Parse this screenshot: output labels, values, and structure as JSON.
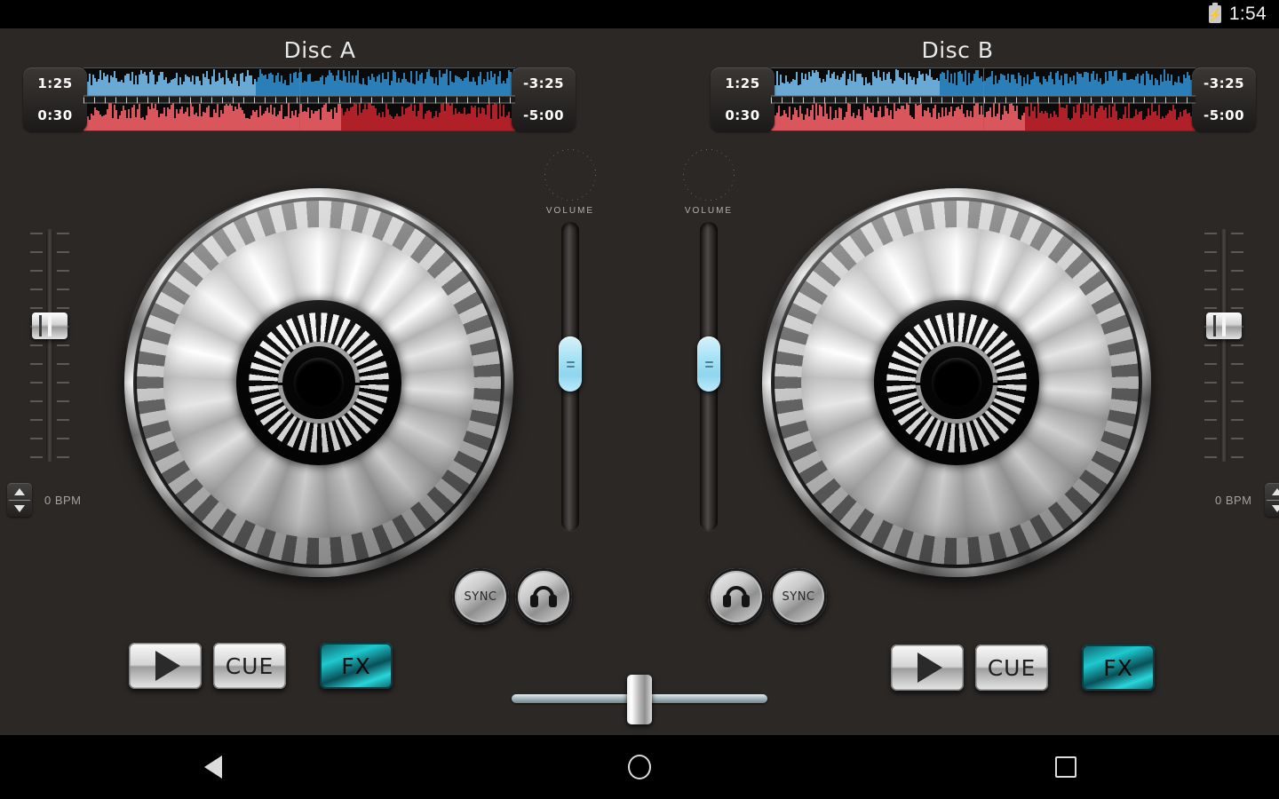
{
  "status_bar": {
    "battery_icon": "battery-charging-icon",
    "time": "1:54"
  },
  "nav_bar": {
    "back_icon": "back-triangle-icon",
    "home_icon": "home-circle-icon",
    "recents_icon": "recents-square-icon"
  },
  "colors": {
    "background": "#2b2826",
    "waveform_top": "#2b7fb8",
    "waveform_bottom": "#b02028",
    "waveform_played_top": "#6aa9d4",
    "waveform_played_bottom": "#d9565c",
    "playhead": "#ff3b30",
    "fx_accent": "#1ec9cf",
    "volume_handle": "#a6e2f5"
  },
  "decks": [
    {
      "id": "a",
      "title": "Disc A",
      "elapsed": "1:25",
      "cue_time": "0:30",
      "remaining": "-3:25",
      "total_remaining": "-5:00",
      "bpm": "0 BPM",
      "play_label": "",
      "cue_label": "CUE",
      "fx_label": "FX",
      "sync_label": "SYNC",
      "monitor_icon": "headphones-icon",
      "volume_knob_label": "VOLUME",
      "play_icon": "play-triangle-icon",
      "pitch_value": 0,
      "channel_volume": 55,
      "playhead_percent": 50
    },
    {
      "id": "b",
      "title": "Disc B",
      "elapsed": "1:25",
      "cue_time": "0:30",
      "remaining": "-3:25",
      "total_remaining": "-5:00",
      "bpm": "0 BPM",
      "play_label": "",
      "cue_label": "CUE",
      "fx_label": "FX",
      "sync_label": "SYNC",
      "monitor_icon": "headphones-icon",
      "volume_knob_label": "VOLUME",
      "play_icon": "play-triangle-icon",
      "pitch_value": 0,
      "channel_volume": 55,
      "playhead_percent": 50
    }
  ],
  "crossfader": {
    "position_percent": 50
  }
}
